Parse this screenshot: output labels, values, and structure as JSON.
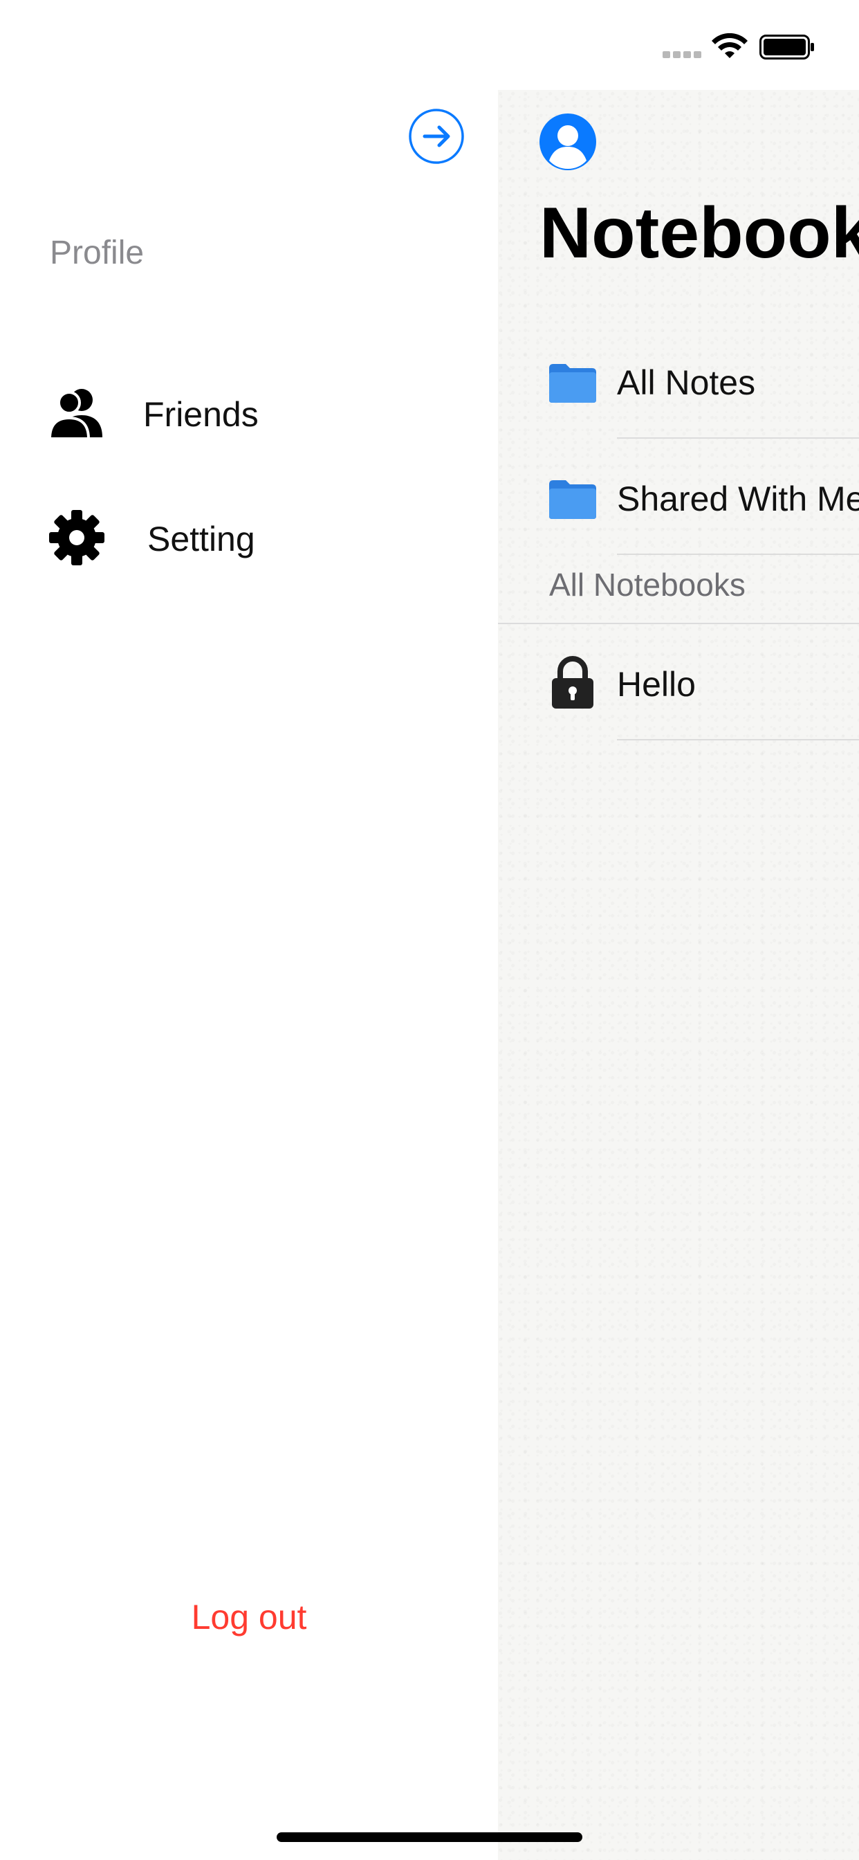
{
  "colors": {
    "accent": "#0a7aff",
    "danger": "#ff3b30",
    "folder": "#3d92ef",
    "secondary_text": "#8a8a8e"
  },
  "drawer": {
    "close_icon": "arrow-right-circle-icon",
    "profile_label": "Profile",
    "items": [
      {
        "label": "Friends",
        "icon": "friends-icon"
      },
      {
        "label": "Setting",
        "icon": "gear-icon"
      }
    ],
    "logout_label": "Log out"
  },
  "main": {
    "avatar_icon": "person-circle-icon",
    "title": "Notebooks",
    "rows": [
      {
        "label": "All Notes",
        "icon": "folder-icon"
      },
      {
        "label": "Shared With Me",
        "icon": "folder-icon"
      }
    ],
    "section_header": "All Notebooks",
    "notebooks": [
      {
        "label": "Hello",
        "icon": "lock-icon"
      }
    ]
  }
}
